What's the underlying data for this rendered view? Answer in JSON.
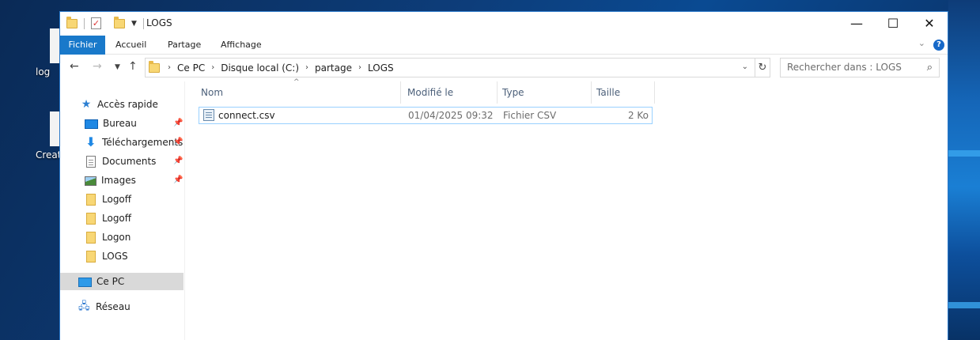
{
  "desktop": {
    "icons": [
      {
        "label": "log"
      },
      {
        "label": "Creat"
      }
    ]
  },
  "window": {
    "title": "LOGS",
    "controls": {
      "minimize": "—",
      "maximize": "☐",
      "close": "✕"
    }
  },
  "ribbon": {
    "tabs": [
      "Fichier",
      "Accueil",
      "Partage",
      "Affichage"
    ],
    "help": "?"
  },
  "navbar": {
    "breadcrumb": [
      "Ce PC",
      "Disque local (C:)",
      "partage",
      "LOGS"
    ],
    "search_placeholder": "Rechercher dans : LOGS"
  },
  "navpane": {
    "quick_access": "Accès rapide",
    "pinned": [
      "Bureau",
      "Téléchargements",
      "Documents",
      "Images"
    ],
    "folders": [
      "Logoff",
      "Logoff",
      "Logon",
      "LOGS"
    ],
    "this_pc": "Ce PC",
    "network": "Réseau"
  },
  "columns": {
    "name": "Nom",
    "modified": "Modifié le",
    "type": "Type",
    "size": "Taille"
  },
  "files": [
    {
      "name": "connect.csv",
      "modified": "01/04/2025 09:32",
      "type": "Fichier CSV",
      "size": "2 Ko"
    }
  ]
}
